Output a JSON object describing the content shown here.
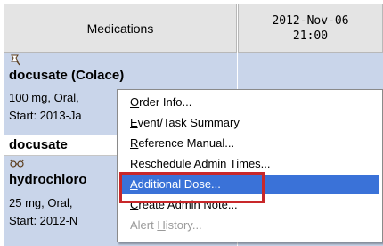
{
  "header": {
    "medications_label": "Medications",
    "time_line1": "2012-Nov-06",
    "time_line2": "21:00"
  },
  "rows": {
    "r1_icon": "bell-pen-icon",
    "r1_name": "docusate (Colace)",
    "r1_line2": "100 mg, Oral,",
    "r1_line3": "Start: 2013-Ja",
    "r2_name": "docusate",
    "r3_icon": "glasses-icon",
    "r3_name": "hydrochloro",
    "r3_line2": "25 mg, Oral, ",
    "r3_line3": "Start: 2012-N"
  },
  "menu": {
    "items": [
      {
        "prefix": "",
        "mnemonic": "O",
        "rest": "rder Info..."
      },
      {
        "prefix": "",
        "mnemonic": "E",
        "rest": "vent/Task Summary"
      },
      {
        "prefix": "",
        "mnemonic": "R",
        "rest": "eference Manual..."
      },
      {
        "prefix": "Reschedule Admin Times...",
        "mnemonic": "",
        "rest": ""
      },
      {
        "prefix": "",
        "mnemonic": "A",
        "rest": "dditional Dose..."
      },
      {
        "prefix": "",
        "mnemonic": "C",
        "rest": "reate Admin Note..."
      },
      {
        "prefix": "Alert ",
        "mnemonic": "H",
        "rest": "istory..."
      }
    ],
    "selected_index": 4,
    "highlight_color": "#c8282a",
    "selection_color": "#3a72d8"
  }
}
